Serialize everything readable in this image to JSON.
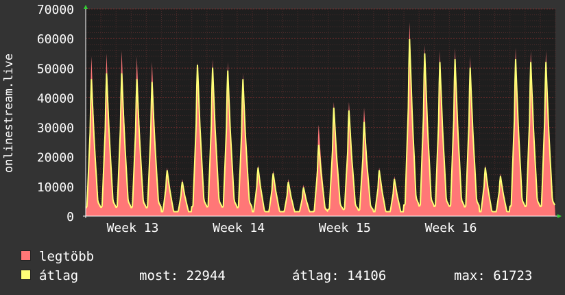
{
  "chart_data": {
    "type": "area",
    "ylabel": "onlinestream.live",
    "ylim": [
      0,
      70000
    ],
    "y_ticks": [
      "0",
      "10000",
      "20000",
      "30000",
      "40000",
      "50000",
      "60000",
      "70000"
    ],
    "x_ticks": [
      "Week 13",
      "Week 14",
      "Week 15",
      "Week 16"
    ],
    "grid": true,
    "x_unit": "days",
    "series": [
      {
        "name": "legtöbb",
        "color": "#ff7777",
        "daily_peaks": [
          56000,
          57000,
          58000,
          56000,
          54000,
          17000,
          13000,
          54000,
          55000,
          54000,
          50000,
          18000,
          16000,
          13000,
          11000,
          32000,
          40000,
          40000,
          38000,
          17000,
          14000,
          68000,
          60000,
          58000,
          59000,
          56000,
          18000,
          15000,
          59000,
          58000,
          58000
        ]
      },
      {
        "name": "átlag",
        "color": "#ffff77",
        "daily_peaks": [
          48000,
          50000,
          50000,
          48000,
          47000,
          16000,
          12000,
          53000,
          52000,
          51000,
          48000,
          17000,
          15000,
          12000,
          10000,
          25000,
          38000,
          37000,
          33000,
          16000,
          13000,
          62000,
          57000,
          54000,
          55000,
          52000,
          17000,
          14000,
          55000,
          54000,
          54000
        ]
      }
    ]
  },
  "legend": {
    "max_label": "legtöbb",
    "avg_label": "átlag"
  },
  "stats": {
    "most": "most: 22944",
    "atlag": "átlag: 14106",
    "max": "max: 61723"
  },
  "colors": {
    "background": "#333333",
    "plot_bg": "#1e1e1e",
    "grid": "#5a2a2a",
    "max_series": "#ff7777",
    "avg_series": "#ffff77"
  }
}
